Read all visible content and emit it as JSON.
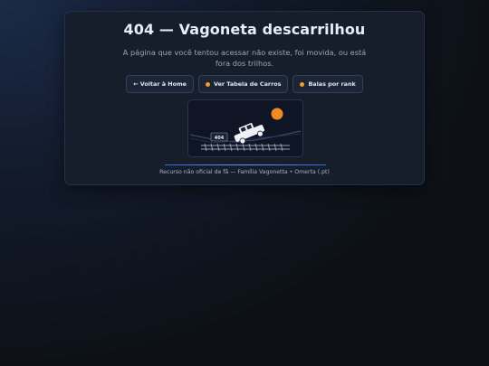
{
  "page": {
    "title": "404 — Vagoneta descarrilhou",
    "description": "A página que você tentou acessar não existe, foi movida, ou está fora dos trilhos."
  },
  "buttons": [
    {
      "label": "← Voltar à Home",
      "dot": false
    },
    {
      "label": "Ver Tabela de Carros",
      "dot": true
    },
    {
      "label": "Balas por rank",
      "dot": true
    }
  ],
  "illustration": {
    "plate_text": "404"
  },
  "footer": {
    "text": "Recurso não oficial de fã — Família Vagonetta • Omerta (.pt)"
  },
  "colors": {
    "accent_dot": "#f0a02a",
    "sun": "#f28a1e",
    "rule": "#4a8cf0"
  }
}
